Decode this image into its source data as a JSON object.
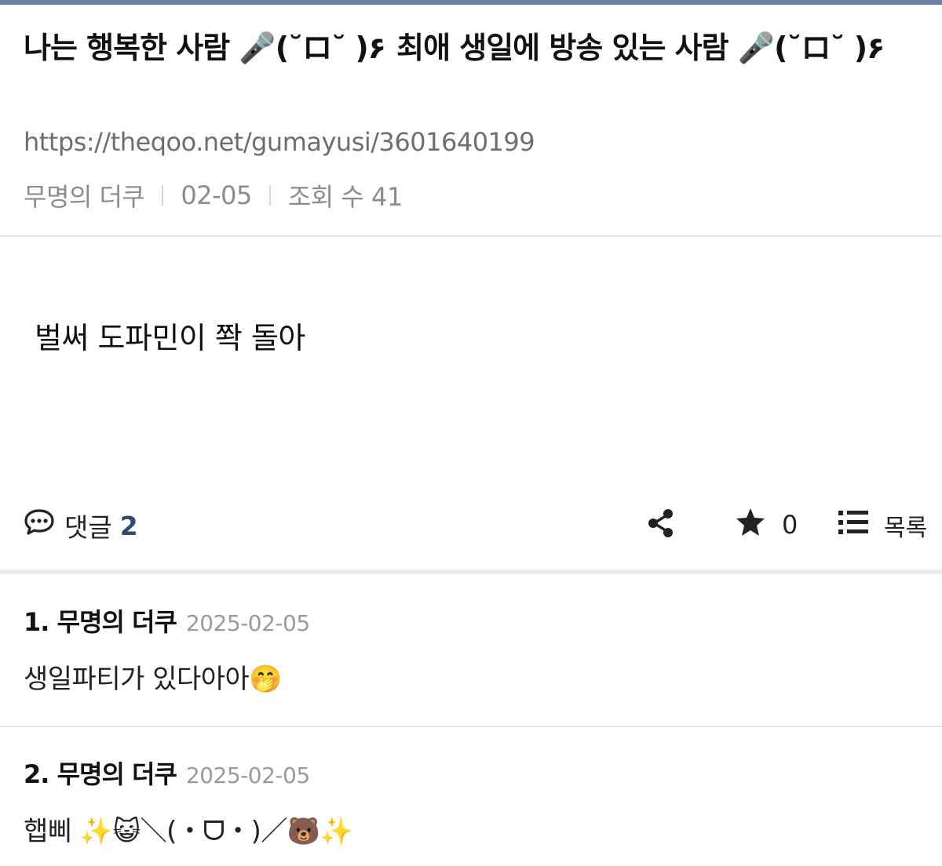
{
  "post": {
    "title": "나는 행복한 사람 🎤(˘ロ˘ )۶ 최애 생일에 방송 있는 사람 🎤(˘ロ˘ )۶",
    "url": "https://theqoo.net/gumayusi/3601640199",
    "author": "무명의 더쿠",
    "date": "02-05",
    "views": "조회 수 41",
    "body": "벌써 도파민이 쫙 돌아"
  },
  "actions": {
    "comments_label": "댓글",
    "comments_count": "2",
    "star_count": "0",
    "list_label": "목록",
    "icons": [
      "speech-bubble-icon",
      "share-icon",
      "star-icon",
      "list-icon"
    ]
  },
  "comments": [
    {
      "number_author": "1. 무명의 더쿠",
      "date": "2025-02-05",
      "text": "생일파티가 있다아아🤭"
    },
    {
      "number_author": "2. 무명의 더쿠",
      "date": "2025-02-05",
      "text": "햅삐 ✨😺＼(・ᗜ・)／🐻✨"
    }
  ],
  "colors": {
    "top_bar": "#6b7fa6",
    "comment_count": "#2f4a6e"
  }
}
